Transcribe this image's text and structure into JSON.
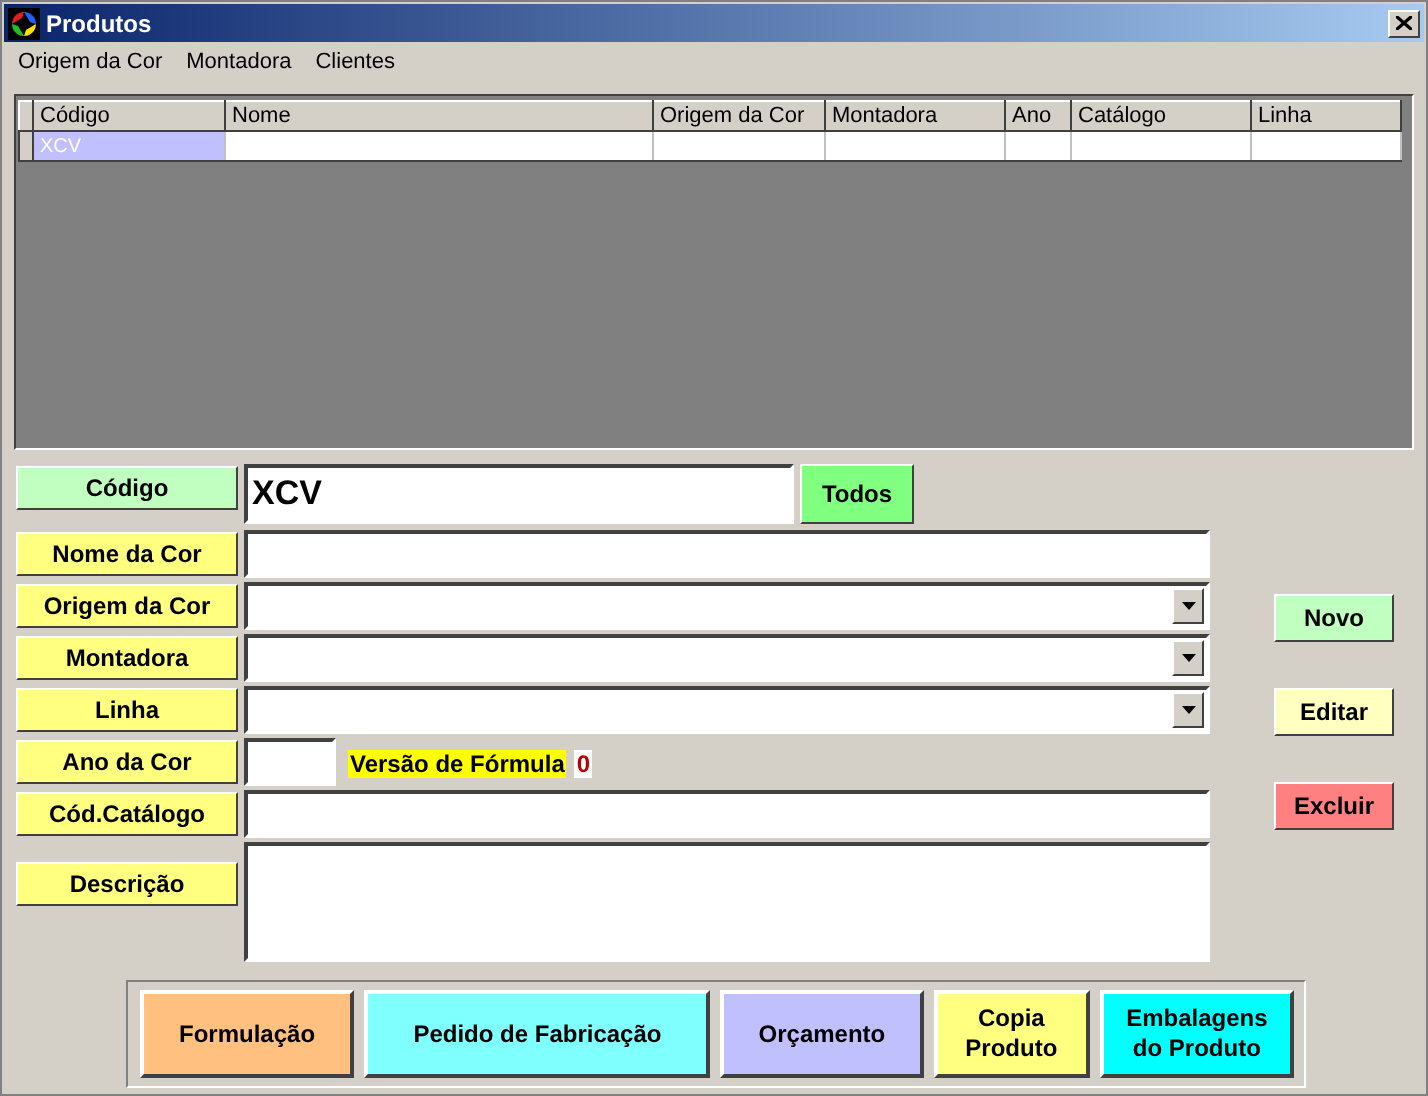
{
  "window": {
    "title": "Produtos"
  },
  "menu": [
    "Origem da Cor",
    "Montadora",
    "Clientes"
  ],
  "table": {
    "columns": [
      "Código",
      "Nome",
      "Origem da Cor",
      "Montadora",
      "Ano",
      "Catálogo",
      "Linha"
    ],
    "rows": [
      {
        "selected": true,
        "cells": [
          "XCV",
          "",
          "",
          "",
          "",
          "",
          ""
        ]
      }
    ]
  },
  "code": {
    "label": "Código",
    "color": "#c0ffc0",
    "value": "XCV",
    "button": "Todos"
  },
  "fields": [
    {
      "label": "Nome da Cor",
      "kind": "text"
    },
    {
      "label": "Origem da Cor",
      "kind": "select"
    },
    {
      "label": "Montadora",
      "kind": "select"
    },
    {
      "label": "Linha",
      "kind": "select"
    },
    {
      "label": "Ano da Cor",
      "kind": "short",
      "note": "Versão de Fórmula",
      "note_value": "0"
    },
    {
      "label": "Cód.Catálogo",
      "kind": "text"
    },
    {
      "label": "Descrição",
      "kind": "textarea"
    }
  ],
  "side_buttons": [
    {
      "label": "Novo",
      "color": "#c0ffc0"
    },
    {
      "label": "Editar",
      "color": "#ffffc0"
    },
    {
      "label": "Excluir",
      "color": "#ff8080"
    }
  ],
  "bottom_buttons": [
    {
      "label": "Formulação",
      "color": "#ffc080"
    },
    {
      "label": "Pedido de Fabricação",
      "color": "#80ffff"
    },
    {
      "label": "Orçamento",
      "color": "#c0c0ff"
    },
    {
      "label": "Copia Produto",
      "color": "#ffff80"
    },
    {
      "label": "Embalagens do Produto",
      "color": "#00ffff"
    }
  ]
}
